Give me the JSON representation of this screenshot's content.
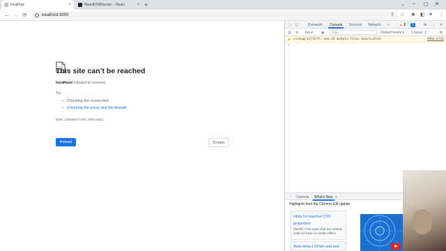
{
  "tabs": [
    {
      "title": "localhost",
      "active": true
    },
    {
      "title": "ReactDOMServer – React",
      "active": false
    }
  ],
  "toolbar": {
    "url": "localhost:8000"
  },
  "error_page": {
    "title": "This site can’t be reached",
    "host": "localhost",
    "message_rest": " refused to connect.",
    "try_label": "Try:",
    "suggestions": [
      "Checking the connection",
      "Checking the proxy and the firewall"
    ],
    "error_code": "ERR_CONNECTION_REFUSED",
    "reload_label": "Reload",
    "details_label": "Details"
  },
  "devtools": {
    "tabs": [
      "Elements",
      "Console",
      "Sources",
      "Network"
    ],
    "more": "»",
    "warn_count": "1",
    "info_count": "1",
    "context": "top",
    "filter_placeholder": "Filter",
    "levels_label": "Default levels",
    "issues_label": "1 Issue:",
    "issues_count": "1",
    "warning": {
      "message": "▸crbug/1173575, non-JS module files deprecated.",
      "source": "VM86:6745"
    },
    "prompt": "›",
    "drawer": {
      "tabs": [
        "Console",
        "What's New"
      ],
      "close": "×",
      "highlights": "Highlights from the Chrome 108 update",
      "card1_title": "Hints for inactive CSS properties",
      "card1_desc": "Identify CSS styles that are entirely valid but have no visible effect.",
      "card2_title": "Auto-detect XPath and text"
    }
  },
  "icons": {
    "back": "←",
    "forward": "→",
    "reload": "⟳",
    "share": "⇪",
    "star": "☆",
    "extensions": "✱",
    "sidebar": "◧",
    "profile": "●",
    "menu": "⋮"
  },
  "colors": {
    "accent": "#1a73e8",
    "warning_bg": "#fffbe5"
  }
}
